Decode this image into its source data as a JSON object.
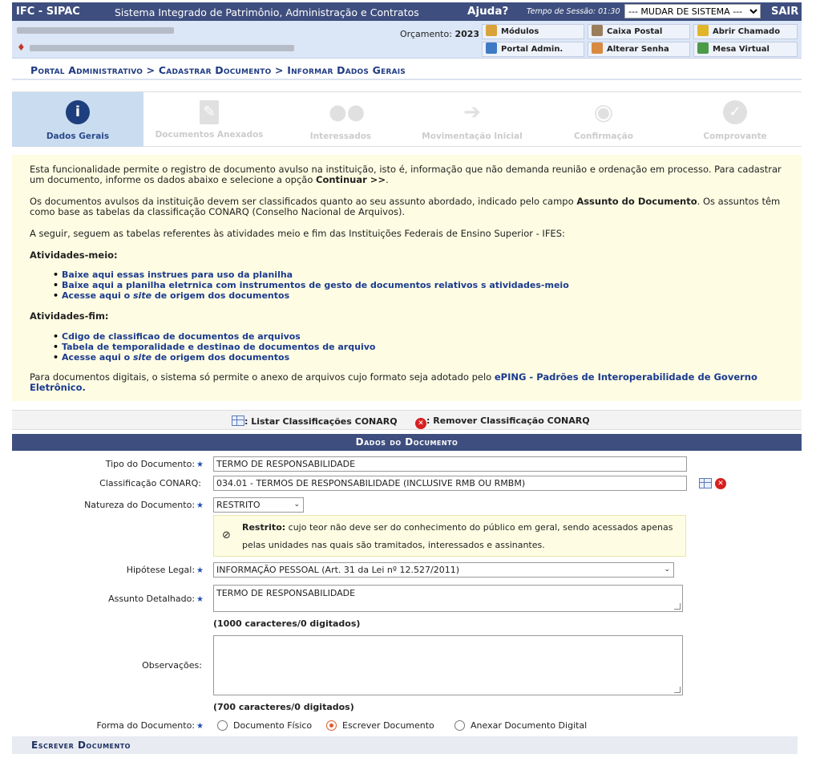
{
  "topbar": {
    "system_code": "IFC - SIPAC",
    "system_name": "Sistema Integrado de Patrimônio, Administração e Contratos",
    "help_label": "Ajuda?",
    "session_label": "Tempo de Sessão: 01:30",
    "change_system": "--- MUDAR DE SISTEMA ---",
    "exit_label": "SAIR"
  },
  "header": {
    "budget_label": "Orçamento:",
    "budget_year": "2023",
    "buttons": [
      "Módulos",
      "Caixa Postal",
      "Abrir Chamado",
      "Portal Admin.",
      "Alterar Senha",
      "Mesa Virtual"
    ]
  },
  "breadcrumb": "Portal Administrativo > Cadastrar Documento > Informar Dados Gerais",
  "steps": [
    {
      "label": "Dados Gerais",
      "icon": "info-icon"
    },
    {
      "label": "Documentos Anexados",
      "icon": "document-clip-icon"
    },
    {
      "label": "Interessados",
      "icon": "people-icon"
    },
    {
      "label": "Movimentação Inicial",
      "icon": "arrow-icon"
    },
    {
      "label": "Confirmação",
      "icon": "eye-icon"
    },
    {
      "label": "Comprovante",
      "icon": "check-icon"
    }
  ],
  "info": {
    "p1a": "Esta funcionalidade permite o registro de documento avulso na instituição, isto é, informação que não demanda reunião e ordenação em processo. Para cadastrar um documento, informe os dados abaixo e selecione a opção ",
    "p1b": "Continuar >>",
    "p1c": ".",
    "p2a": "Os documentos avulsos da instituição devem ser classificados quanto ao seu assunto abordado, indicado pelo campo ",
    "p2b": "Assunto do Documento",
    "p2c": ". Os assuntos têm como base as tabelas da classificação CONARQ (Conselho Nacional de Arquivos).",
    "p3": "A seguir, seguem as tabelas referentes às atividades meio e fim das Instituições Federais de Ensino Superior - IFES:",
    "meio_title": "Atividades-meio:",
    "meio_links": [
      "Baixe aqui essas instrues para uso da planilha",
      "Baixe aqui a planilha eletrnica com instrumentos de gesto de documentos relativos s atividades-meio"
    ],
    "site_pre": "Acesse aqui o ",
    "site_word": "site",
    "site_post": " de origem dos documentos",
    "fim_title": "Atividades-fim:",
    "fim_links": [
      "Cdigo de classificao de documentos de arquivos",
      "Tabela de temporalidade e destinao de documentos de arquivo"
    ],
    "p4a": "Para documentos digitais, o sistema só permite o anexo de arquivos cujo formato seja adotado pelo ",
    "p4b": "ePING - Padrões de Interoperabilidade de Governo Eletrônico."
  },
  "actions": {
    "list": ": Listar Classificações CONARQ",
    "remove": ": Remover Classificação CONARQ"
  },
  "form": {
    "title": "Dados do Documento",
    "tipo_label": "Tipo do Documento:",
    "tipo_value": "TERMO DE RESPONSABILIDADE",
    "class_label": "Classificação CONARQ:",
    "class_value": "034.01 - TERMOS DE RESPONSABILIDADE (INCLUSIVE RMB OU RMBM)",
    "natureza_label": "Natureza do Documento:",
    "natureza_value": "RESTRITO",
    "restrito_title": "Restrito:",
    "restrito_text": "cujo teor não deve ser do conhecimento do público em geral, sendo acessados apenas pelas unidades nas quais são tramitados, interessados e assinantes.",
    "hipotese_label": "Hipótese Legal:",
    "hipotese_value": "INFORMAÇÃO PESSOAL (Art. 31 da Lei nº 12.527/2011)",
    "assunto_label": "Assunto Detalhado:",
    "assunto_value": "TERMO DE RESPONSABILIDADE",
    "assunto_counter": "(1000 caracteres/0 digitados)",
    "obs_label": "Observações:",
    "obs_value": "",
    "obs_counter": "(700 caracteres/0 digitados)",
    "forma_label": "Forma do Documento:",
    "forma_options": [
      "Documento Físico",
      "Escrever Documento",
      "Anexar Documento Digital"
    ],
    "forma_selected": "Escrever Documento",
    "write_section": "Escrever Documento"
  }
}
